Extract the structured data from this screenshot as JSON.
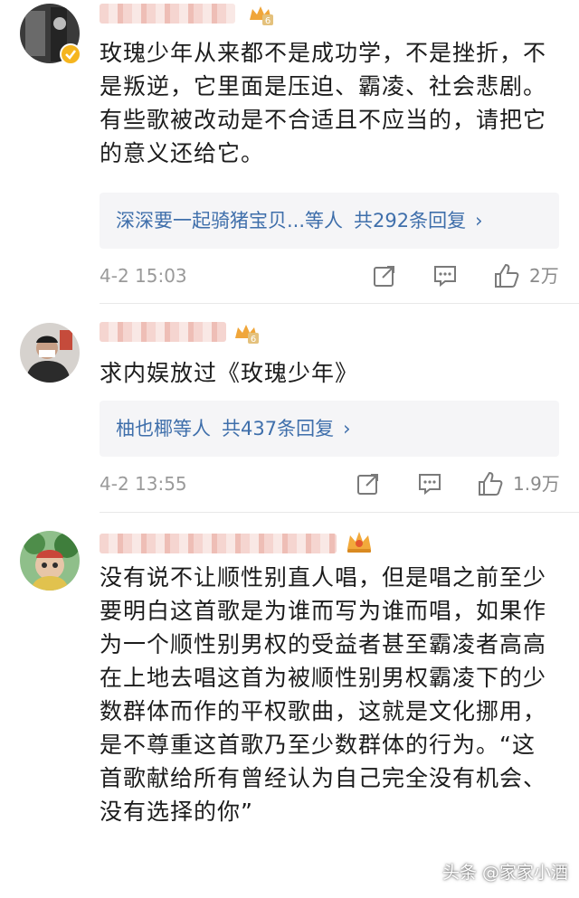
{
  "comments": [
    {
      "text": "玫瑰少年从来都不是成功学，不是挫折，不是叛逆，它里面是压迫、霸凌、社会悲剧。有些歌被改动是不合适且不应当的，请把它的意义还给它。",
      "reply_names": "深深要一起骑猪宝贝...等人",
      "reply_count": "共292条回复",
      "chevron": "›",
      "time": "4-2 15:03",
      "likes": "2万",
      "level": "6"
    },
    {
      "text": "求内娱放过《玫瑰少年》",
      "reply_names": "柚也椰等人",
      "reply_count": "共437条回复",
      "chevron": "›",
      "time": "4-2 13:55",
      "likes": "1.9万",
      "level": "6"
    },
    {
      "text": "没有说不让顺性别直人唱，但是唱之前至少要明白这首歌是为谁而写为谁而唱，如果作为一个顺性别男权的受益者甚至霸凌者高高在上地去唱这首为被顺性别男权霸凌下的少数群体而作的平权歌曲，这就是文化挪用，是不尊重这首歌乃至少数群体的行为。“这首歌献给所有曾经认为自己完全没有机会、没有选择的你”"
    }
  ],
  "watermark": "头条 @家家小酒",
  "colors": {
    "link": "#3f6fab",
    "meta": "#9a9a9a",
    "reply_bg": "#f5f5f7",
    "badge": "#f0a63a"
  }
}
